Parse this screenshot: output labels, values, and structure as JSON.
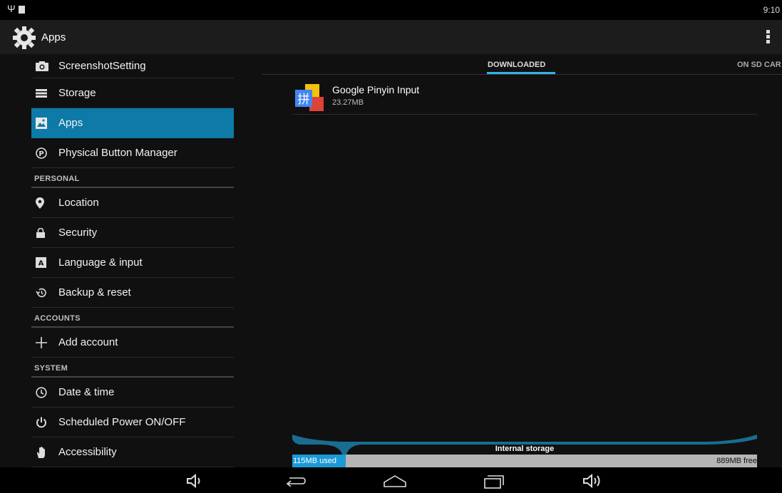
{
  "status_bar": {
    "time": "9:10"
  },
  "action_bar": {
    "title": "Apps"
  },
  "sidebar": {
    "items": [
      {
        "type": "item",
        "label": "ScreenshotSetting",
        "icon": "camera-icon",
        "short": true
      },
      {
        "type": "item",
        "label": "Storage",
        "icon": "storage-icon"
      },
      {
        "type": "item",
        "label": "Apps",
        "icon": "apps-icon",
        "selected": true
      },
      {
        "type": "item",
        "label": "Physical Button Manager",
        "icon": "p-circle-icon"
      },
      {
        "type": "section",
        "label": "PERSONAL"
      },
      {
        "type": "item",
        "label": "Location",
        "icon": "location-pin-icon"
      },
      {
        "type": "item",
        "label": "Security",
        "icon": "lock-icon"
      },
      {
        "type": "item",
        "label": "Language & input",
        "icon": "keyboard-a-icon"
      },
      {
        "type": "item",
        "label": "Backup & reset",
        "icon": "backup-icon"
      },
      {
        "type": "section",
        "label": "ACCOUNTS"
      },
      {
        "type": "item",
        "label": "Add account",
        "icon": "plus-icon"
      },
      {
        "type": "section",
        "label": "SYSTEM"
      },
      {
        "type": "item",
        "label": "Date & time",
        "icon": "clock-icon"
      },
      {
        "type": "item",
        "label": "Scheduled Power ON/OFF",
        "icon": "power-icon"
      },
      {
        "type": "item",
        "label": "Accessibility",
        "icon": "hand-icon"
      }
    ]
  },
  "tabs": {
    "active": "DOWNLOADED",
    "second": "ON SD CAR"
  },
  "apps": [
    {
      "name": "Google Pinyin Input",
      "size": "23.27MB",
      "icon_char": "拼"
    }
  ],
  "storage": {
    "label": "Internal storage",
    "used": "115MB used",
    "free": "889MB free",
    "used_fraction": 0.115
  },
  "colors": {
    "accent": "#33b5e5",
    "selected": "#0e7aa8",
    "used_bar": "#1a9ad6"
  }
}
